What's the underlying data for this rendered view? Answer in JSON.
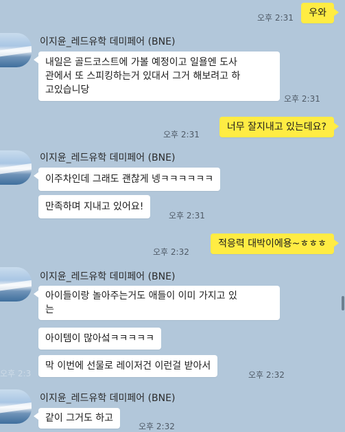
{
  "sender_name": "이지윤_레드유학 데미페어 (BNE)",
  "faint_overlay": "오후 2:3",
  "messages": [
    {
      "text": "우와",
      "time": "오후 2:31"
    },
    {
      "line1": "내일은 골드코스트에 가볼 예정이고 일욜엔 도사",
      "line2": "관에서 또 스피킹하는거 있대서 그거 해보려고 하",
      "line3": "고있습니당",
      "time": "오후 2:31"
    },
    {
      "text": "너무 잘지내고 있는데요?",
      "time": "오후 2:31"
    },
    {
      "text": "이주차인데 그래도 괜찮게 넹ㅋㅋㅋㅋㅋㅋ"
    },
    {
      "text": "만족하며 지내고 있어요!",
      "time": "오후 2:31"
    },
    {
      "text": "적응력 대박이에용~ㅎㅎㅎ",
      "time": "오후 2:32"
    },
    {
      "line1": "아이들이랑 놀아주는거도 애들이 이미 가지고 있",
      "line2": "는"
    },
    {
      "text": "아이템이 많아섴ㅋㅋㅋㅋㅋ"
    },
    {
      "text": "막 이번에 선물로 레이저건 이런걸 받아서",
      "time": "오후 2:32"
    },
    {
      "text": "같이 그거도 하고",
      "time": "오후 2:32"
    }
  ]
}
